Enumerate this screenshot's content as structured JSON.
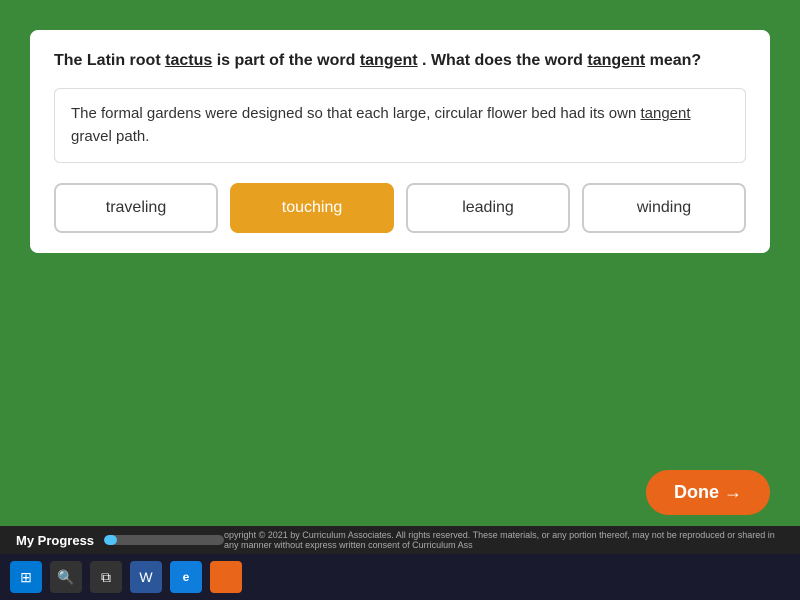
{
  "question": {
    "text_prefix": "The Latin root ",
    "root_word": "tactus",
    "text_middle": " is part of the word ",
    "target_word": "tangent",
    "text_suffix": ". What does the word ",
    "target_word2": "tangent",
    "text_end": " mean?"
  },
  "context": {
    "text_prefix": "The formal gardens were designed so that each large, circular flower bed had its own ",
    "underline_word": "tangent",
    "text_suffix": " gravel path."
  },
  "options": [
    {
      "id": "traveling",
      "label": "traveling",
      "selected": false
    },
    {
      "id": "touching",
      "label": "touching",
      "selected": true
    },
    {
      "id": "leading",
      "label": "leading",
      "selected": false
    },
    {
      "id": "winding",
      "label": "winding",
      "selected": false
    }
  ],
  "done_button": {
    "label": "Done →"
  },
  "progress": {
    "label": "My Progress",
    "percent": "11% complete",
    "fill_width": "11%"
  },
  "copyright": "opyright © 2021 by Curriculum Associates. All rights reserved. These materials, or any portion thereof, may not be reproduced or shared in any manner without express written consent of Curriculum Ass"
}
